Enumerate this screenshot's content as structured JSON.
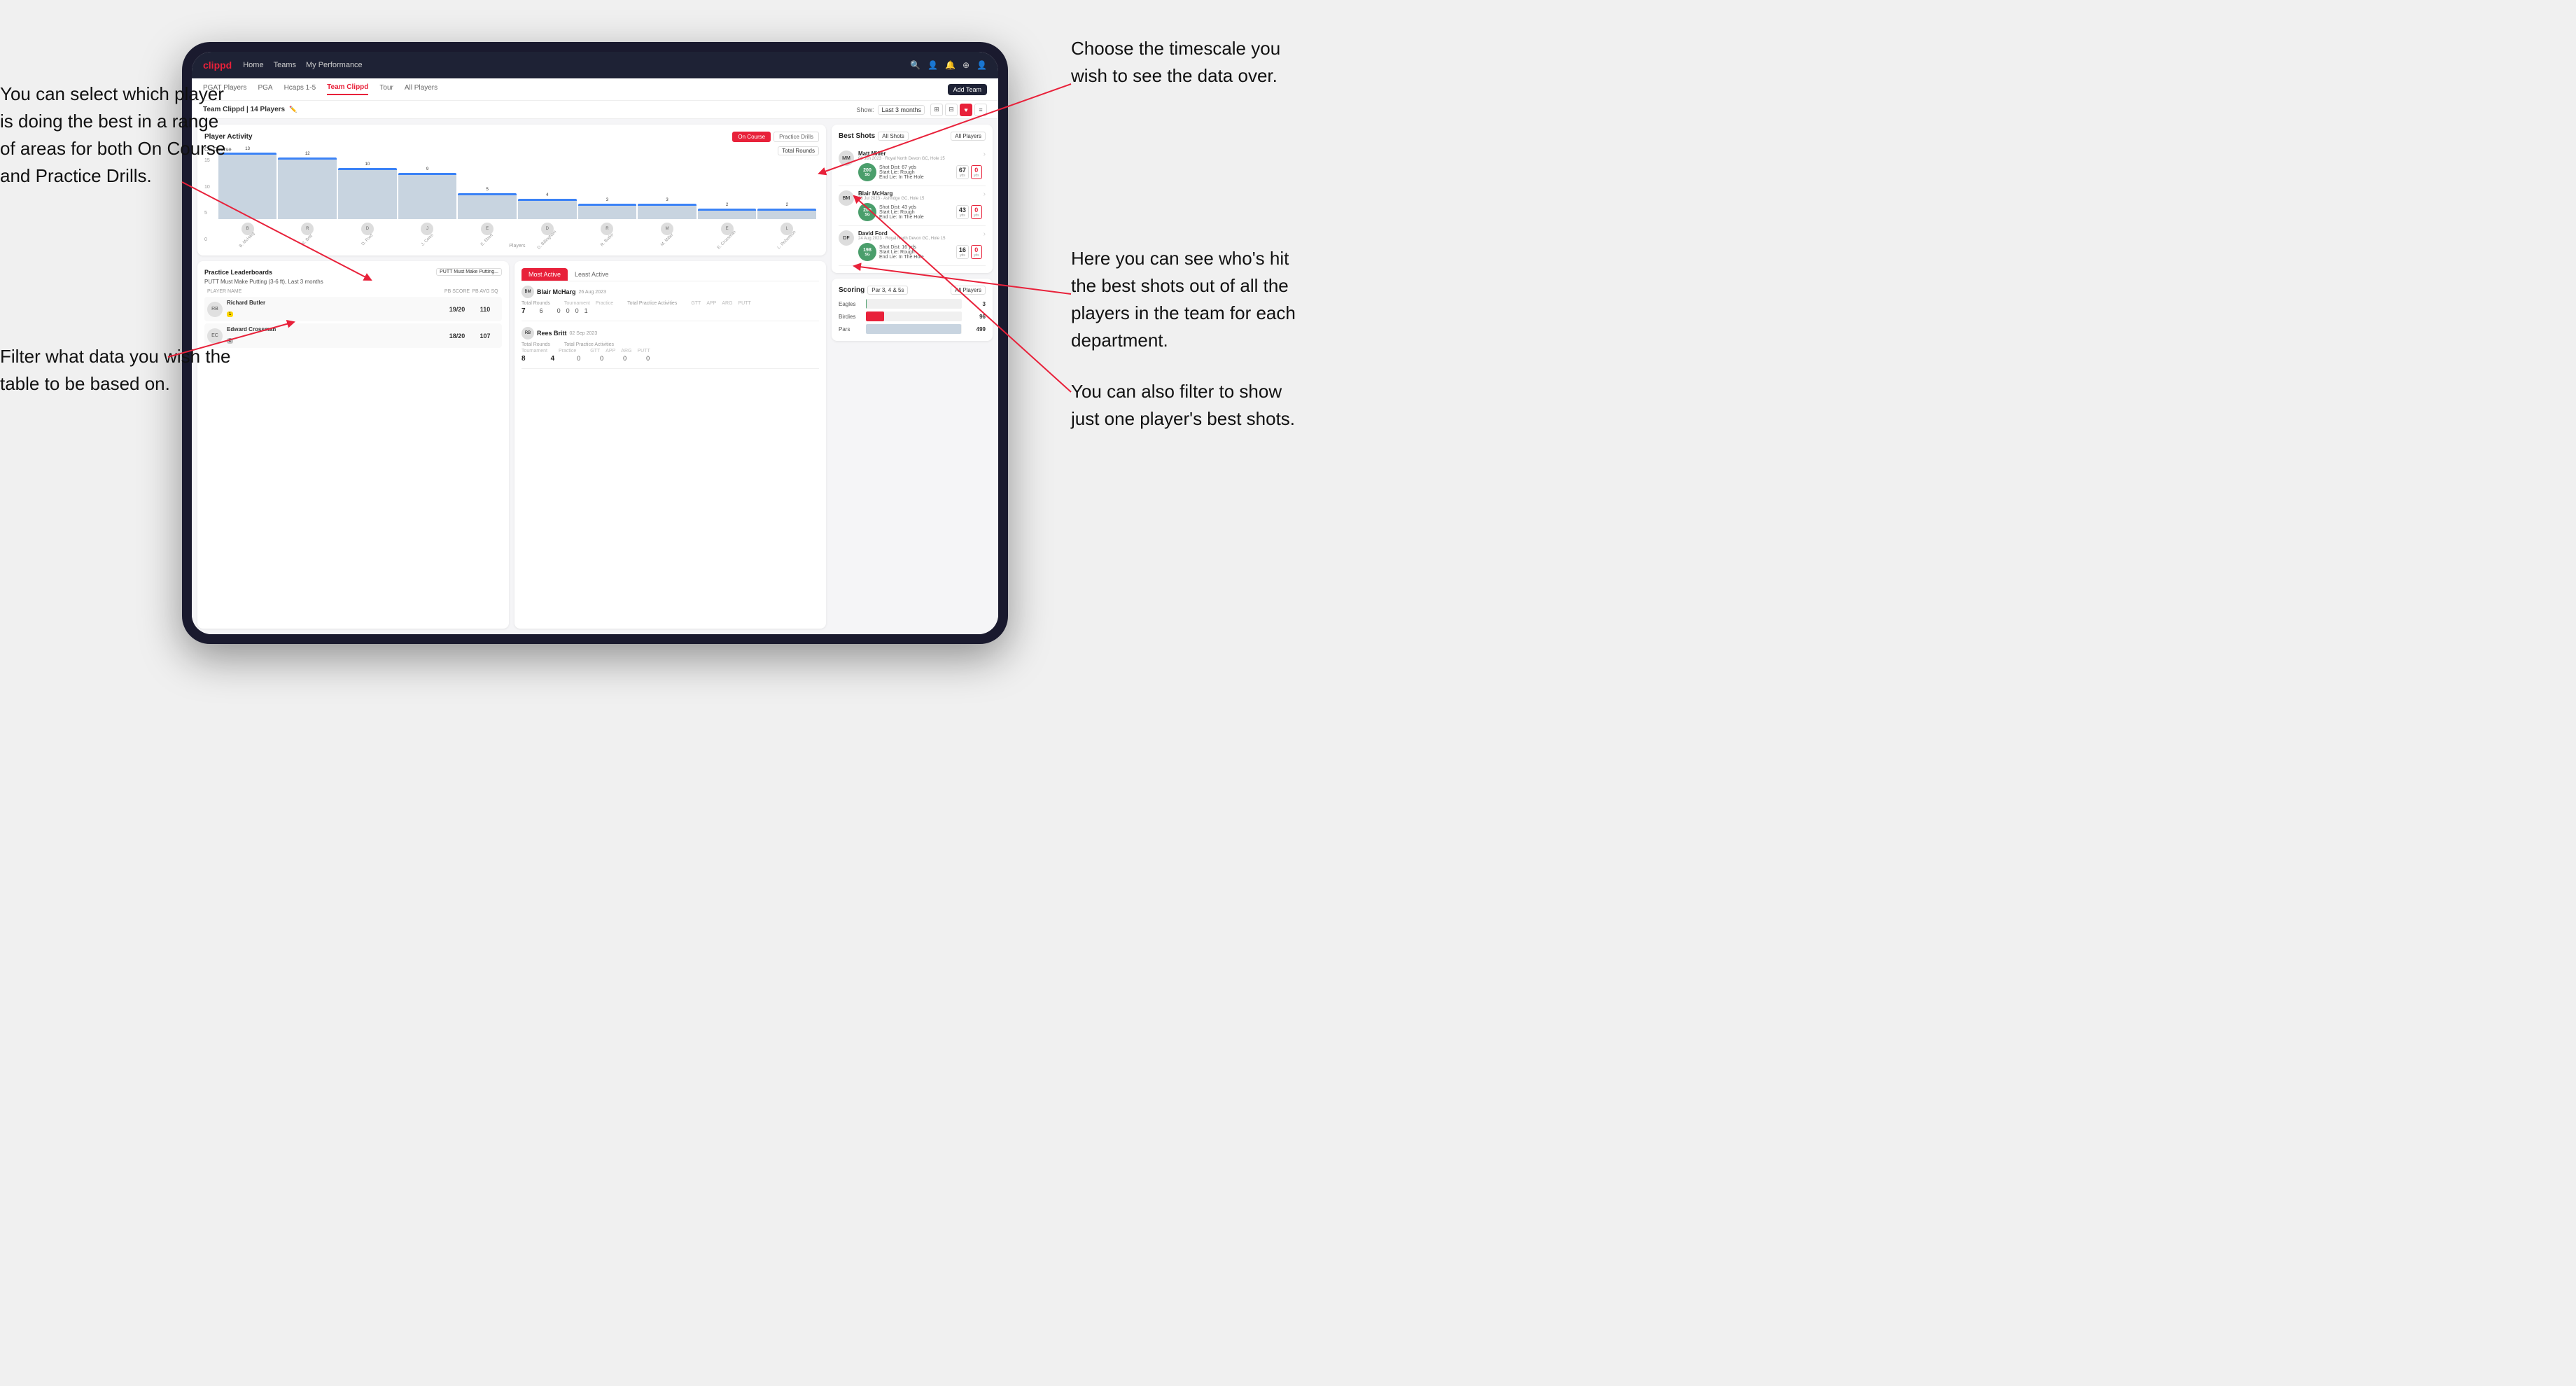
{
  "annotations": {
    "top_right": {
      "text": "Choose the timescale you wish to see the data over."
    },
    "top_left": {
      "text": "You can select which player is doing the best in a range of areas for both On Course and Practice Drills."
    },
    "bottom_left": {
      "text": "Filter what data you wish the table to be based on."
    },
    "bottom_right_1": {
      "text": "Here you can see who's hit the best shots out of all the players in the team for each department."
    },
    "bottom_right_2": {
      "text": "You can also filter to show just one player's best shots."
    }
  },
  "navbar": {
    "logo": "clippd",
    "items": [
      "Home",
      "Teams",
      "My Performance"
    ],
    "icons": [
      "search",
      "person",
      "bell",
      "add",
      "avatar"
    ]
  },
  "tabs": {
    "items": [
      "PGAT Players",
      "PGA",
      "Hcaps 1-5",
      "Team Clippd",
      "Tour",
      "All Players"
    ],
    "active": "Team Clippd",
    "add_button": "Add Team"
  },
  "sub_header": {
    "team_label": "Team Clippd | 14 Players",
    "show_label": "Show:",
    "show_value": "Last 3 months",
    "view_icons": [
      "grid-large",
      "grid-small",
      "heart",
      "settings"
    ]
  },
  "player_activity": {
    "title": "Player Activity",
    "tabs": [
      "On Course",
      "Practice Drills"
    ],
    "active_tab": "On Course",
    "section_label": "On Course",
    "chart_filter": "Total Rounds",
    "y_labels": [
      "15",
      "10",
      "5",
      "0"
    ],
    "bars": [
      {
        "name": "B. McHarg",
        "value": 13
      },
      {
        "name": "R. Britt",
        "value": 12
      },
      {
        "name": "D. Ford",
        "value": 10
      },
      {
        "name": "J. Coles",
        "value": 9
      },
      {
        "name": "E. Ebert",
        "value": 5
      },
      {
        "name": "D. Billingham",
        "value": 4
      },
      {
        "name": "R. Butler",
        "value": 3
      },
      {
        "name": "M. Miller",
        "value": 3
      },
      {
        "name": "E. Crossman",
        "value": 2
      },
      {
        "name": "L. Robertson",
        "value": 2
      }
    ],
    "x_label": "Players"
  },
  "practice_leaderboards": {
    "title": "Practice Leaderboards",
    "filter": "PUTT Must Make Putting...",
    "name": "PUTT Must Make Putting (3-6 ft), Last 3 months",
    "headers": {
      "player": "PLAYER NAME",
      "pb": "PB SCORE",
      "avg": "PB AVG SQ"
    },
    "rows": [
      {
        "name": "Richard Butler",
        "badge": "1",
        "pb": "19/20",
        "avg": "110"
      },
      {
        "name": "Edward Crossman",
        "badge": "2",
        "pb": "18/20",
        "avg": "107"
      }
    ]
  },
  "most_active": {
    "tabs": [
      "Most Active",
      "Least Active"
    ],
    "active": "Most Active",
    "players": [
      {
        "name": "Blair McHarg",
        "date": "26 Aug 2023",
        "rounds_label": "Total Rounds",
        "practice_label": "Total Practice Activities",
        "tournament_label": "Tournament",
        "practice_sub_label": "Practice",
        "gtt_label": "GTT",
        "app_label": "APP",
        "arg_label": "ARG",
        "putt_label": "PUTT",
        "tournament_val": "7",
        "practice_val": "6",
        "gtt_val": "0",
        "app_val": "0",
        "arg_val": "0",
        "putt_val": "1"
      },
      {
        "name": "Rees Britt",
        "date": "02 Sep 2023",
        "tournament_val": "8",
        "practice_val": "4",
        "gtt_val": "0",
        "app_val": "0",
        "arg_val": "0",
        "putt_val": "0"
      }
    ]
  },
  "best_shots": {
    "title": "Best Shots",
    "filter": "All Shots",
    "players_filter": "All Players",
    "shots": [
      {
        "player": "Matt Miller",
        "course": "09 Jun 2023 · Royal North Devon GC, Hole 15",
        "badge_val": "200",
        "badge_sub": "SG",
        "dist": "Shot Dist: 67 yds\nStart Lie: Rough\nEnd Lie: In The Hole",
        "yds1": "67",
        "yds1_label": "yds",
        "yds2": "0",
        "yds2_label": "yds"
      },
      {
        "player": "Blair McHarg",
        "course": "23 Jul 2023 · Ashridge GC, Hole 15",
        "badge_val": "200",
        "badge_sub": "SG",
        "dist": "Shot Dist: 43 yds\nStart Lie: Rough\nEnd Lie: In The Hole",
        "yds1": "43",
        "yds1_label": "yds",
        "yds2": "0",
        "yds2_label": "yds"
      },
      {
        "player": "David Ford",
        "course": "24 Aug 2023 · Royal North Devon GC, Hole 15",
        "badge_val": "198",
        "badge_sub": "SG",
        "dist": "Shot Dist: 16 yds\nStart Lie: Rough\nEnd Lie: In The Hole",
        "yds1": "16",
        "yds1_label": "yds",
        "yds2": "0",
        "yds2_label": "yds"
      }
    ]
  },
  "scoring": {
    "title": "Scoring",
    "filter": "Par 3, 4 & 5s",
    "players_filter": "All Players",
    "rows": [
      {
        "label": "Eagles",
        "value": 3,
        "max": 500,
        "color": "#4a9e6b"
      },
      {
        "label": "Birdies",
        "value": 96,
        "max": 500,
        "color": "#e8213a"
      },
      {
        "label": "Pars",
        "value": 499,
        "max": 500,
        "color": "#c8d4e0"
      }
    ]
  }
}
